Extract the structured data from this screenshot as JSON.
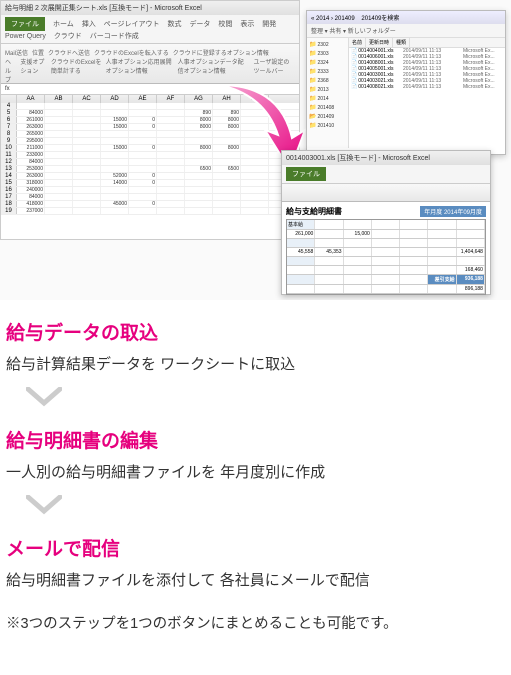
{
  "excel1": {
    "title": "給与明細 2 次展開正集シート.xls [互換モード] - Microsoft Excel",
    "file_tab": "ファイル",
    "tabs": [
      "ホーム",
      "挿入",
      "ページレイアウト",
      "数式",
      "データ",
      "校閲",
      "表示",
      "開発",
      "Power Query",
      "クラウド",
      "バーコード作成"
    ],
    "ribbon_items": [
      "Mail送信",
      "位置",
      "クラウドへ送信",
      "クラウドのExcelを転入する",
      "クラウドに登録するオプション情報",
      "ヘルプ",
      "支援オプション",
      "クラウドのExcelを簡単計する",
      "人事オプション応用展開オプション情報",
      "人事オプションデータ配信オプション情報",
      "ユーザ設定のツールバー"
    ],
    "formula_bar": "fx",
    "col_letters": [
      "AA",
      "AB",
      "AC",
      "AD",
      "AE",
      "AF",
      "AG",
      "AH",
      "AI"
    ],
    "rows": [
      {
        "n": 4,
        "c": [
          "",
          "",
          "",
          "",
          "",
          "",
          "",
          "",
          ""
        ]
      },
      {
        "n": 5,
        "c": [
          "84000",
          "",
          "",
          "",
          "",
          "",
          "890",
          "890",
          ""
        ]
      },
      {
        "n": 6,
        "c": [
          "261000",
          "",
          "",
          "15000",
          "0",
          "",
          "8000",
          "8000",
          ""
        ]
      },
      {
        "n": 7,
        "c": [
          "263000",
          "",
          "",
          "15000",
          "0",
          "",
          "8000",
          "8000",
          ""
        ]
      },
      {
        "n": 8,
        "c": [
          "265000",
          "",
          "",
          "",
          "",
          "",
          "",
          "",
          ""
        ]
      },
      {
        "n": 9,
        "c": [
          "295000",
          "",
          "",
          "",
          "",
          "",
          "",
          "",
          ""
        ]
      },
      {
        "n": 10,
        "c": [
          "211000",
          "",
          "",
          "15000",
          "0",
          "",
          "8000",
          "8000",
          ""
        ]
      },
      {
        "n": 11,
        "c": [
          "233000",
          "",
          "",
          "",
          "",
          "",
          "",
          "",
          ""
        ]
      },
      {
        "n": 12,
        "c": [
          "84000",
          "",
          "",
          "",
          "",
          "",
          "",
          "",
          ""
        ]
      },
      {
        "n": 13,
        "c": [
          "253000",
          "",
          "",
          "",
          "",
          "",
          "6500",
          "6500",
          ""
        ]
      },
      {
        "n": 14,
        "c": [
          "263000",
          "",
          "",
          "52000",
          "0",
          "",
          "",
          "",
          ""
        ]
      },
      {
        "n": 15,
        "c": [
          "318000",
          "",
          "",
          "14000",
          "0",
          "",
          "",
          "",
          ""
        ]
      },
      {
        "n": 16,
        "c": [
          "240000",
          "",
          "",
          "",
          "",
          "",
          "",
          "",
          ""
        ]
      },
      {
        "n": 17,
        "c": [
          "84000",
          "",
          "",
          "",
          "",
          "",
          "",
          "",
          ""
        ]
      },
      {
        "n": 18,
        "c": [
          "418000",
          "",
          "",
          "45000",
          "0",
          "",
          "",
          "",
          ""
        ]
      },
      {
        "n": 19,
        "c": [
          "237000",
          "",
          "",
          "",
          "",
          "",
          "",
          "",
          ""
        ]
      }
    ]
  },
  "explorer": {
    "title": "201409",
    "breadcrumb": " « 2014 › 201409",
    "search": "201409を検索",
    "toolbar": "整理 ▾  共有 ▾  新しいフォルダー",
    "tree_items": [
      "2302",
      "2303",
      "2324",
      "2333",
      "2368",
      "2013",
      "2014",
      "201408",
      "201409",
      "201410"
    ],
    "open_folder_index": 8,
    "headers": [
      "名前",
      "更新日時",
      "種類"
    ],
    "files": [
      {
        "name": "0014004001.xls",
        "date": "2014/09/11 11:13",
        "type": "Microsoft Ex..."
      },
      {
        "name": "0014006001.xls",
        "date": "2014/09/11 11:13",
        "type": "Microsoft Ex..."
      },
      {
        "name": "0014008001.xls",
        "date": "2014/09/11 11:13",
        "type": "Microsoft Ex..."
      },
      {
        "name": "0014005001.xls",
        "date": "2014/09/11 11:13",
        "type": "Microsoft Ex..."
      },
      {
        "name": "0014003001.xls",
        "date": "2014/09/11 11:13",
        "type": "Microsoft Ex..."
      },
      {
        "name": "0014003021.xls",
        "date": "2014/09/11 11:13",
        "type": "Microsoft Ex..."
      },
      {
        "name": "0014008021.xls",
        "date": "2014/09/11 11:13",
        "type": "Microsoft Ex..."
      }
    ]
  },
  "excel2": {
    "title": "0014003001.xls [互換モード] - Microsoft Excel",
    "report_title": "給与支給明細書",
    "year_month_label": "年月度",
    "year_month": "2014年09月度",
    "rows": [
      [
        {
          "t": "基本給",
          "label": true
        },
        {
          "t": ""
        },
        {
          "t": ""
        },
        {
          "t": ""
        },
        {
          "t": ""
        },
        {
          "t": ""
        },
        {
          "t": ""
        }
      ],
      [
        {
          "t": "261,000"
        },
        {
          "t": ""
        },
        {
          "t": "15,000"
        },
        {
          "t": ""
        },
        {
          "t": ""
        },
        {
          "t": ""
        },
        {
          "t": ""
        }
      ],
      [
        {
          "t": "",
          "label": true
        },
        {
          "t": ""
        },
        {
          "t": ""
        },
        {
          "t": ""
        },
        {
          "t": ""
        },
        {
          "t": ""
        },
        {
          "t": ""
        }
      ],
      [
        {
          "t": "45,558"
        },
        {
          "t": "45,353"
        },
        {
          "t": ""
        },
        {
          "t": ""
        },
        {
          "t": ""
        },
        {
          "t": ""
        },
        {
          "t": "1,404,648"
        }
      ],
      [
        {
          "t": "",
          "label": true
        },
        {
          "t": ""
        },
        {
          "t": ""
        },
        {
          "t": ""
        },
        {
          "t": ""
        },
        {
          "t": ""
        },
        {
          "t": ""
        }
      ],
      [
        {
          "t": ""
        },
        {
          "t": ""
        },
        {
          "t": ""
        },
        {
          "t": ""
        },
        {
          "t": ""
        },
        {
          "t": ""
        },
        {
          "t": "168,460"
        }
      ],
      [
        {
          "t": "",
          "label": true
        },
        {
          "t": ""
        },
        {
          "t": ""
        },
        {
          "t": ""
        },
        {
          "t": ""
        },
        {
          "t": "差引支給",
          "total": true
        },
        {
          "t": "936,188",
          "total": true
        }
      ],
      [
        {
          "t": ""
        },
        {
          "t": ""
        },
        {
          "t": ""
        },
        {
          "t": ""
        },
        {
          "t": ""
        },
        {
          "t": ""
        },
        {
          "t": "896,188"
        }
      ]
    ]
  },
  "steps": [
    {
      "title": "給与データの取込",
      "desc": "給与計算結果データを ワークシートに取込"
    },
    {
      "title": "給与明細書の編集",
      "desc": "一人別の給与明細書ファイルを 年月度別に作成"
    },
    {
      "title": "メールで配信",
      "desc": "給与明細書ファイルを添付して 各社員にメールで配信"
    }
  ],
  "note": "※3つのステップを1つのボタンにまとめることも可能です。"
}
